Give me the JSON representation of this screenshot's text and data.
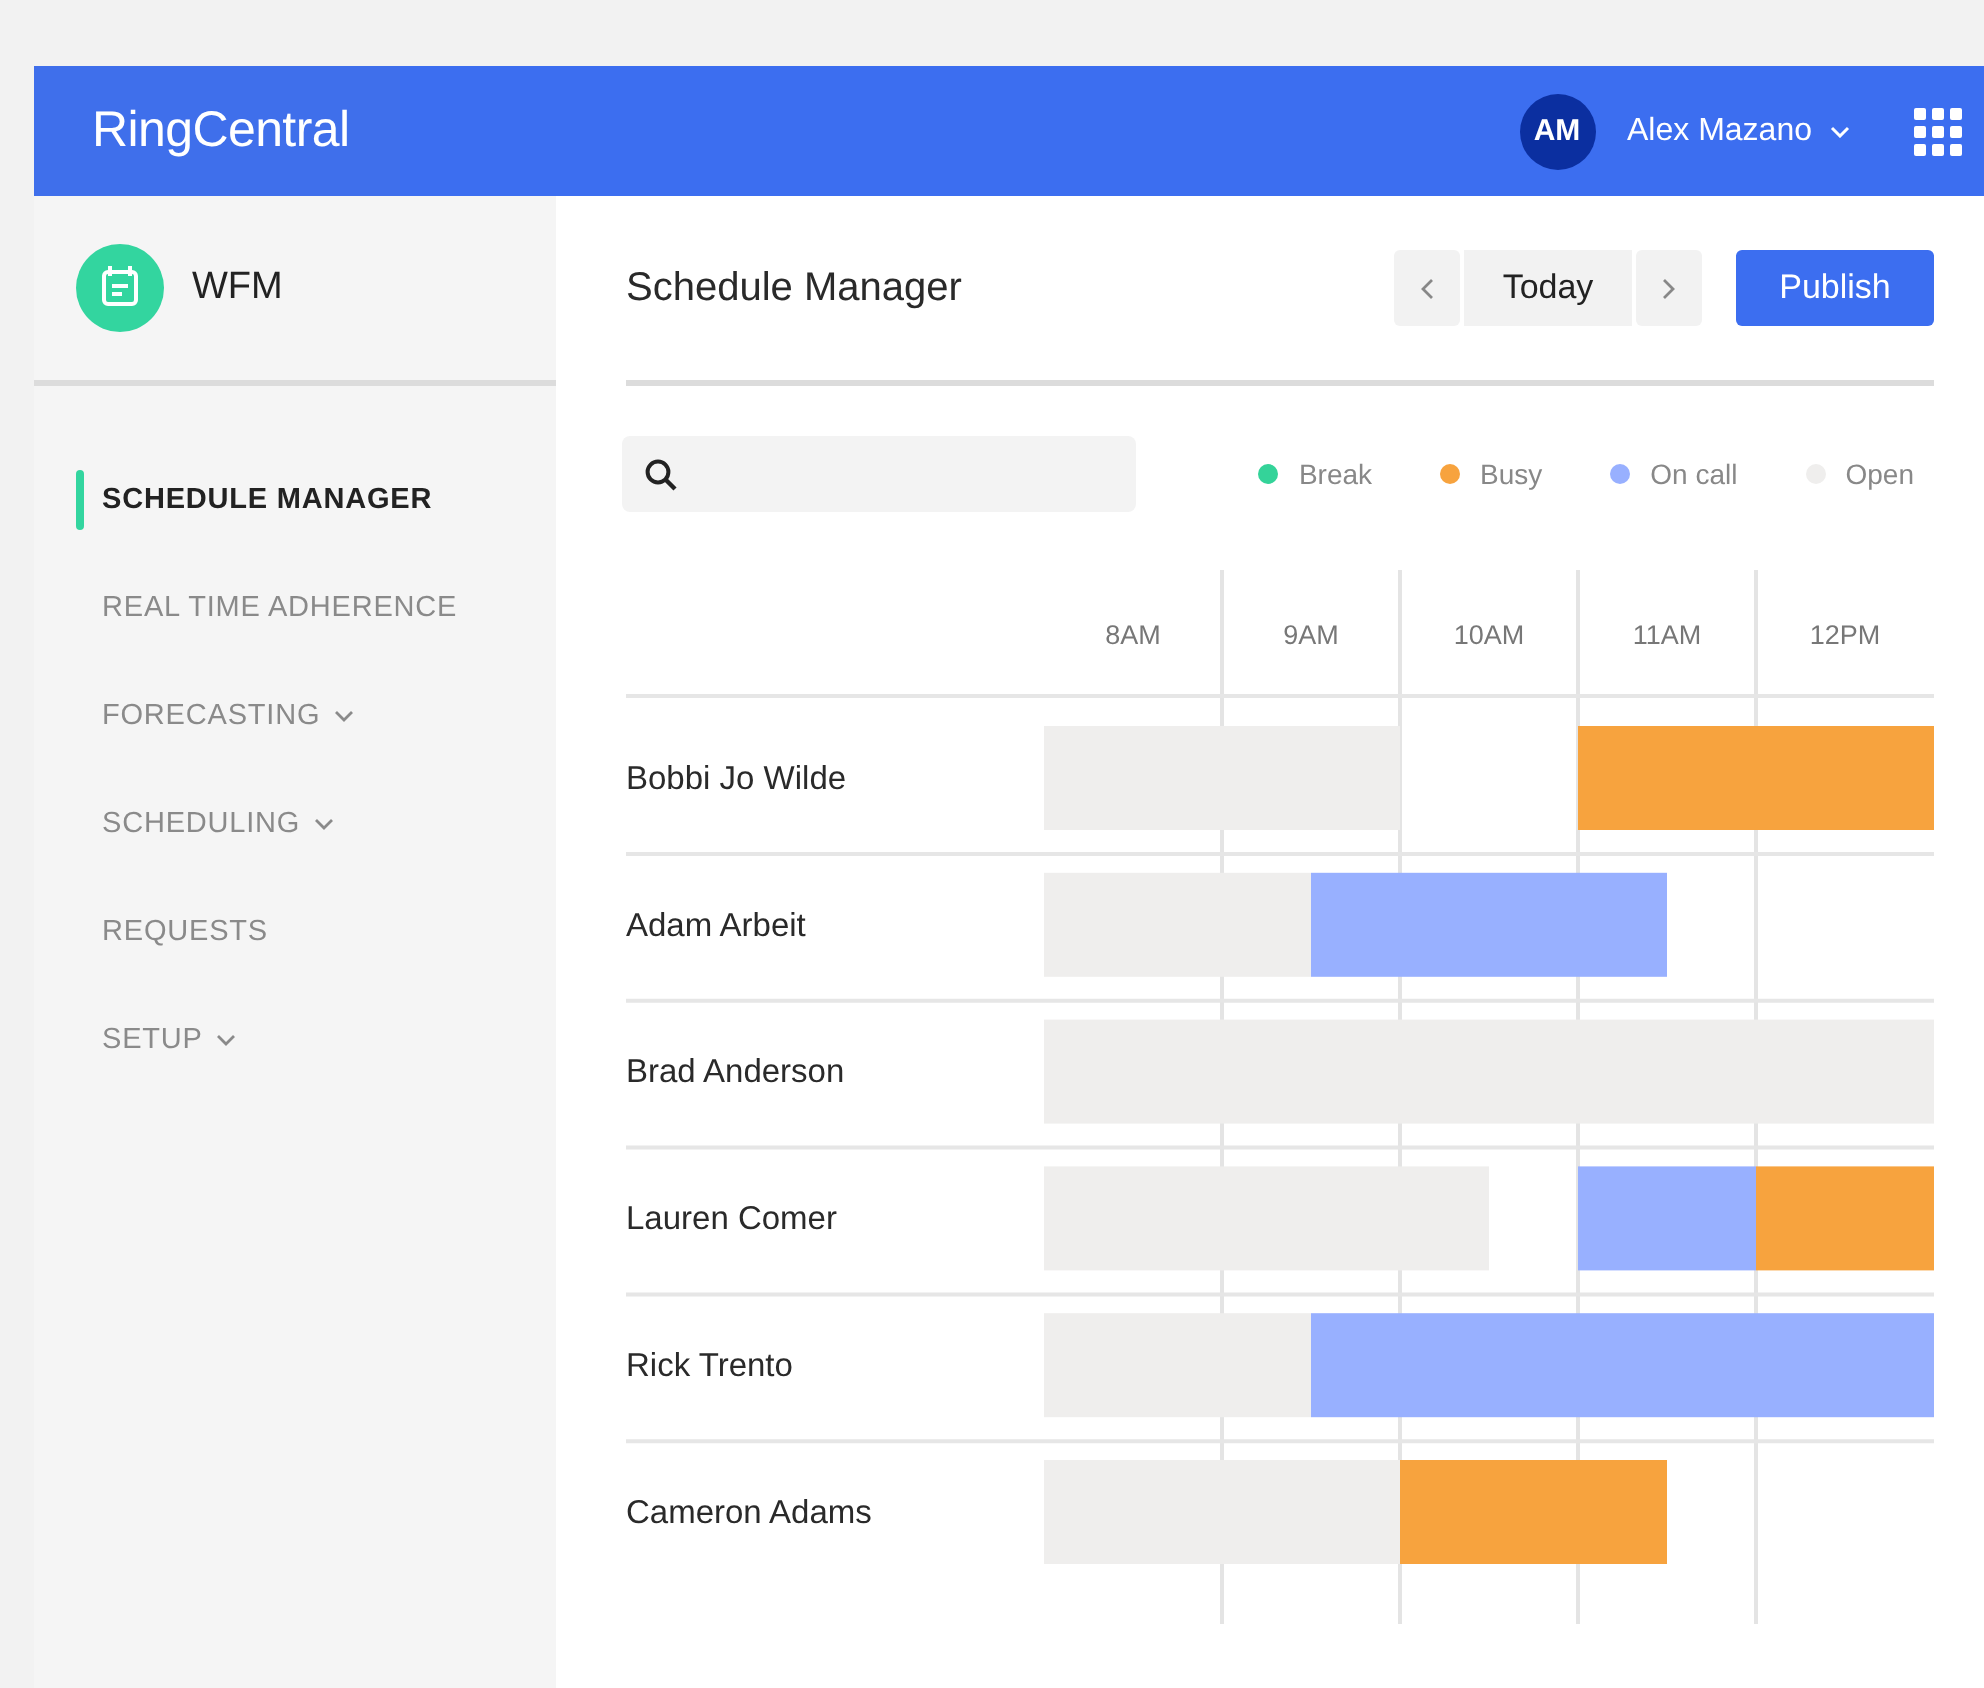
{
  "header": {
    "logo": "RingCentral",
    "user": {
      "initials": "AM",
      "name": "Alex Mazano"
    }
  },
  "sidebar": {
    "app": {
      "title": "WFM"
    },
    "items": [
      {
        "label": "SCHEDULE MANAGER",
        "selected": true,
        "expandable": false
      },
      {
        "label": "REAL TIME ADHERENCE",
        "selected": false,
        "expandable": false
      },
      {
        "label": "FORECASTING",
        "selected": false,
        "expandable": true
      },
      {
        "label": "SCHEDULING",
        "selected": false,
        "expandable": true
      },
      {
        "label": "REQUESTS",
        "selected": false,
        "expandable": false
      },
      {
        "label": "SETUP",
        "selected": false,
        "expandable": true
      }
    ]
  },
  "main": {
    "title": "Schedule Manager",
    "today_button": "Today",
    "publish_button": "Publish",
    "legend": [
      {
        "label": "Break",
        "kind": "break",
        "color": "#34d399"
      },
      {
        "label": "Busy",
        "kind": "busy",
        "color": "#f7a33e"
      },
      {
        "label": "On call",
        "kind": "on_call",
        "color": "#98b0ff"
      },
      {
        "label": "Open",
        "kind": "open",
        "color": "#efeeed"
      }
    ],
    "hours": [
      "8AM",
      "9AM",
      "10AM",
      "11AM",
      "12PM"
    ],
    "rows": [
      {
        "name": "Bobbi Jo Wilde",
        "slots": [
          {
            "kind": "open"
          },
          {
            "kind": "open"
          },
          {
            "kind": "open"
          },
          {
            "kind": "open"
          },
          {
            "kind": "none"
          },
          {
            "kind": "none"
          },
          {
            "kind": "busy"
          },
          {
            "kind": "busy"
          },
          {
            "kind": "busy"
          },
          {
            "kind": "busy"
          }
        ]
      },
      {
        "name": "Adam Arbeit",
        "slots": [
          {
            "kind": "open"
          },
          {
            "kind": "open"
          },
          {
            "kind": "open"
          },
          {
            "kind": "on_call"
          },
          {
            "kind": "on_call"
          },
          {
            "kind": "on_call"
          },
          {
            "kind": "on_call"
          },
          {
            "kind": "none"
          },
          {
            "kind": "none"
          },
          {
            "kind": "none"
          }
        ]
      },
      {
        "name": "Brad Anderson",
        "slots": [
          {
            "kind": "open"
          },
          {
            "kind": "open"
          },
          {
            "kind": "open"
          },
          {
            "kind": "open"
          },
          {
            "kind": "open"
          },
          {
            "kind": "open"
          },
          {
            "kind": "open"
          },
          {
            "kind": "open"
          },
          {
            "kind": "open"
          },
          {
            "kind": "open"
          }
        ]
      },
      {
        "name": "Lauren Comer",
        "slots": [
          {
            "kind": "open"
          },
          {
            "kind": "open"
          },
          {
            "kind": "open"
          },
          {
            "kind": "open"
          },
          {
            "kind": "open"
          },
          {
            "kind": "none"
          },
          {
            "kind": "on_call"
          },
          {
            "kind": "on_call"
          },
          {
            "kind": "busy"
          },
          {
            "kind": "busy"
          }
        ]
      },
      {
        "name": "Rick Trento",
        "slots": [
          {
            "kind": "open"
          },
          {
            "kind": "open"
          },
          {
            "kind": "open"
          },
          {
            "kind": "on_call"
          },
          {
            "kind": "on_call"
          },
          {
            "kind": "on_call"
          },
          {
            "kind": "on_call"
          },
          {
            "kind": "on_call"
          },
          {
            "kind": "on_call"
          },
          {
            "kind": "on_call"
          }
        ]
      },
      {
        "name": "Cameron Adams",
        "slots": [
          {
            "kind": "open"
          },
          {
            "kind": "open"
          },
          {
            "kind": "open"
          },
          {
            "kind": "open"
          },
          {
            "kind": "busy"
          },
          {
            "kind": "busy"
          },
          {
            "kind": "busy"
          },
          {
            "kind": "none"
          },
          {
            "kind": "none"
          },
          {
            "kind": "none"
          }
        ]
      }
    ]
  }
}
